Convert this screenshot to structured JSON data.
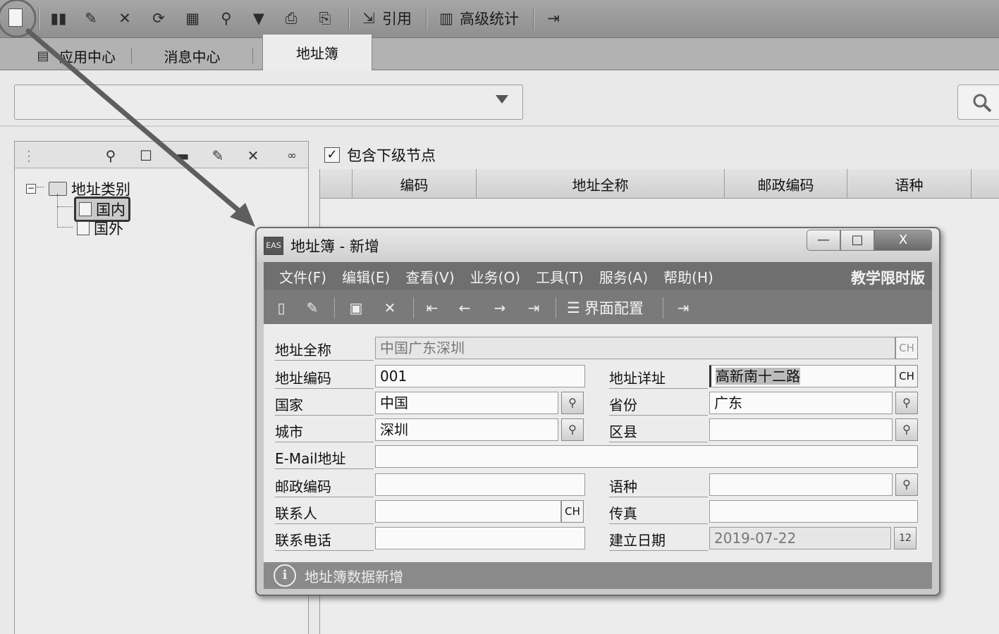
{
  "toolbar": {
    "quote_label": "引用",
    "advanced_stats_label": "高级统计",
    "icons": [
      "new-doc-icon",
      "binoculars-icon",
      "edit-icon",
      "delete-icon",
      "refresh-icon",
      "calculator-icon",
      "find-icon",
      "filter-icon",
      "print-icon",
      "print-preview-icon",
      "quote-icon",
      "stats-icon",
      "exit-icon"
    ]
  },
  "tabs": [
    {
      "label": "应用中心"
    },
    {
      "label": "消息中心"
    },
    {
      "label": "地址簿"
    }
  ],
  "left_panel": {
    "tree_root": "地址类别",
    "tree_children": [
      "国内",
      "国外"
    ]
  },
  "right_panel": {
    "include_subnodes_label": "包含下级节点",
    "include_subnodes_checked": true,
    "columns": [
      "编码",
      "地址全称",
      "邮政编码",
      "语种"
    ]
  },
  "dialog": {
    "app_icon_text": "EAS",
    "title": "地址簿 - 新增",
    "window_controls": {
      "minimize": "—",
      "maximize": "□",
      "close": "X"
    },
    "menu": [
      "文件(F)",
      "编辑(E)",
      "查看(V)",
      "业务(O)",
      "工具(T)",
      "服务(A)",
      "帮助(H)"
    ],
    "edition": "教学限时版",
    "ui_config_label": "界面配置",
    "fields": {
      "full_address": {
        "label": "地址全称",
        "value": "中国广东深圳",
        "lang": "CH"
      },
      "address_code": {
        "label": "地址编码",
        "value": "001"
      },
      "address_detail": {
        "label": "地址详址",
        "value": "高新南十二路",
        "lang": "CH"
      },
      "country": {
        "label": "国家",
        "value": "中国"
      },
      "province": {
        "label": "省份",
        "value": "广东"
      },
      "city": {
        "label": "城市",
        "value": "深圳"
      },
      "district": {
        "label": "区县",
        "value": ""
      },
      "email": {
        "label": "E-Mail地址",
        "value": ""
      },
      "postal_code": {
        "label": "邮政编码",
        "value": ""
      },
      "language": {
        "label": "语种",
        "value": ""
      },
      "contact": {
        "label": "联系人",
        "value": "",
        "lang": "CH"
      },
      "fax": {
        "label": "传真",
        "value": ""
      },
      "phone": {
        "label": "联系电话",
        "value": ""
      },
      "created_date": {
        "label": "建立日期",
        "value": "2019-07-22",
        "calendar_text": "12"
      }
    },
    "status_text": "地址簿数据新增"
  }
}
